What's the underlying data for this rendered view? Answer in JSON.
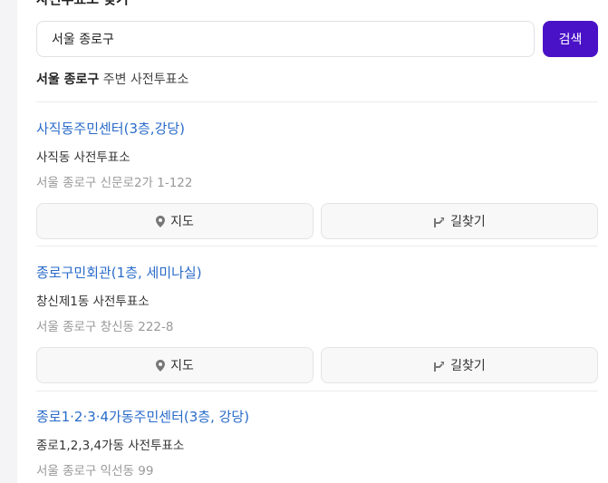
{
  "section": {
    "title": "사전투표소 찾기"
  },
  "search": {
    "value": "서울 종로구",
    "button_label": "검색"
  },
  "nearby": {
    "region": "서울 종로구",
    "suffix": " 주변 사전투표소"
  },
  "buttons": {
    "map_label": "지도",
    "route_label": "길찾기"
  },
  "places": [
    {
      "name": "사직동주민센터(3층,강당)",
      "district": "사직동 사전투표소",
      "address": "서울 종로구 신문로2가 1-122"
    },
    {
      "name": "종로구민회관(1층, 세미나실)",
      "district": "창신제1동 사전투표소",
      "address": "서울 종로구 창신동 222-8"
    },
    {
      "name": "종로1·2·3·4가동주민센터(3층, 강당)",
      "district": "종로1,2,3,4가동 사전투표소",
      "address": "서울 종로구 익선동 99"
    }
  ]
}
